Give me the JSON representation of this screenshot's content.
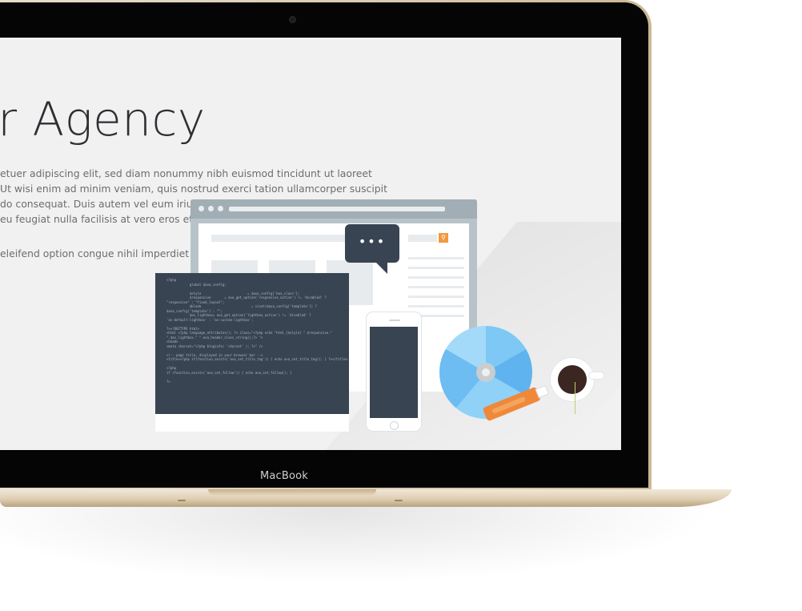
{
  "device": {
    "brand_label": "MacBook"
  },
  "hero": {
    "title": "ur Agency",
    "paragraph_lines": [
      "etuer adipiscing elit, sed diam nonummy nibh euismod tincidunt ut laoreet",
      "Ut wisi enim ad minim veniam, quis nostrud exerci tation ullamcorper suscipit",
      "do consequat. Duis autem vel eum iriure dolor in hendrerit in vulputate velit esse",
      "eu feugiat nulla facilisis at vero eros et accumsan et iusto odio",
      "eleifend option congue nihil imperdiet doming."
    ]
  },
  "illustration": {
    "bubble_dots": "•••",
    "search_button_icon": "search-icon",
    "code_snippet": "<?php\n            global $ava_config;\n\n            $style                        = $ava_config['box_class'];\n            $responsive       = ava_get_option('responsive_active') != 'disabled' ?\n\"responsive\" : \"fixed_layout\";\n            $blank                          = isset($ava_config['template']) ?\n$ava_config['template'] : \"\";\n            $av_lightbox= ava_get_option('lightbox_active') != 'disabled' ?\n'av-default-lightbox' : 'av-custom-lightbox';\n\n?><!DOCTYPE html>\n<html <?php language_attributes(); ?> class=\"<?php echo \"html_{$style} \".$responsive.\"\n\".$av_lightbox.\" \".ava_header_class_string();?> \">\n<head>\n<meta charset=\"<?php bloginfo( 'charset' ); ?>\" />\n\n<!-- page title, displayed in your browser bar -->\n<title><?php if(function_exists('ava_set_title_tag')) { echo ava_set_title_tag(); } ?></title>\n\n<?php\nif (function_exists('ava_set_follow')) { echo ava_set_follow(); }\n\n?>",
    "colors": {
      "navy": "#384452",
      "orange": "#f0883a",
      "disc_blue": "#7ec8f5",
      "browser_gray": "#b8c3c9"
    }
  }
}
